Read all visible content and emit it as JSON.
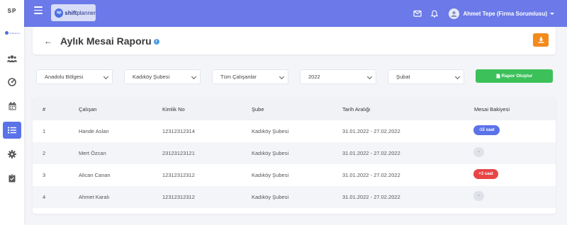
{
  "sidebar": {
    "logo": "SP",
    "brand_text": "shiftplanner",
    "items": [
      {
        "icon": "users-icon"
      },
      {
        "icon": "dashboard-icon"
      },
      {
        "icon": "calendar-icon"
      },
      {
        "icon": "list-icon",
        "active": true
      },
      {
        "icon": "settings-icon"
      },
      {
        "icon": "clipboard-check-icon"
      }
    ]
  },
  "header": {
    "logo_initials": "sp",
    "logo_bold": "shift",
    "logo_light": "planner",
    "user_name": "Ahmet Tepe (Firma Sorumlusu)"
  },
  "page": {
    "title": "Aylık Mesai Raporu",
    "info": "i"
  },
  "filters": {
    "region": "Anadolu Bölgesi",
    "branch": "Kadıköy Şubesi",
    "employees": "Tüm Çalışanlar",
    "year": "2022",
    "month": "Şubat",
    "report_button": "Rapor Oluştur"
  },
  "table": {
    "headers": [
      "#",
      "Çalışan",
      "Kimlik No",
      "Şube",
      "Tarih Aralığı",
      "Mesai Bakiyesi"
    ],
    "rows": [
      {
        "num": "1",
        "name": "Hande Aslan",
        "id": "12312312314",
        "branch": "Kadıköy Şubesi",
        "range": "31.01.2022 - 27.02.2022",
        "balance": "-15 saat",
        "status": "blue"
      },
      {
        "num": "2",
        "name": "Mert Özcan",
        "id": "23123123121",
        "branch": "Kadıköy Şubesi",
        "range": "31.01.2022 - 27.02.2022",
        "balance": "-",
        "status": "gray"
      },
      {
        "num": "3",
        "name": "Alican Canan",
        "id": "12312312312",
        "branch": "Kadıköy Şubesi",
        "range": "31.01.2022 - 27.02.2022",
        "balance": "+3 saat",
        "status": "red"
      },
      {
        "num": "4",
        "name": "Ahmet Karalı",
        "id": "12312312312",
        "branch": "Kadıköy Şubesi",
        "range": "31.01.2022 - 27.02.2022",
        "balance": "-",
        "status": "gray"
      }
    ]
  },
  "colors": {
    "header": "#6b7ae8",
    "accent": "#5b73e8",
    "download": "#f28b1b",
    "report": "#3cc15a",
    "negative": "#5b73e8",
    "positive": "#e84545"
  }
}
